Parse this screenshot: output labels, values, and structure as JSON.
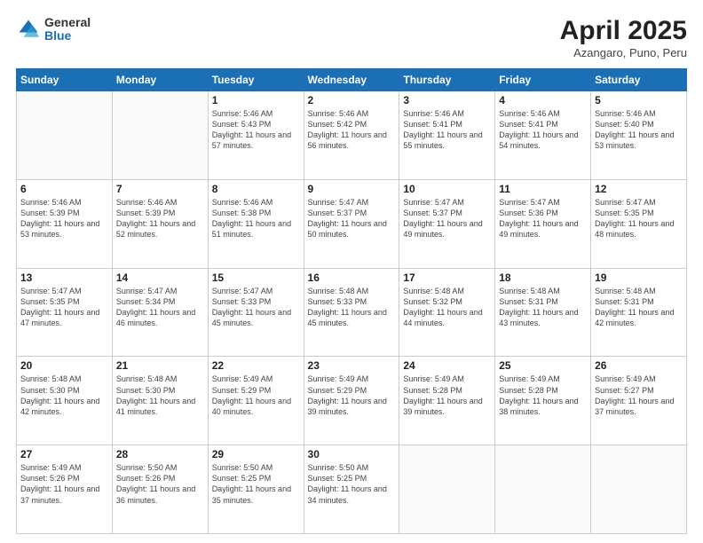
{
  "header": {
    "logo_general": "General",
    "logo_blue": "Blue",
    "title": "April 2025",
    "subtitle": "Azangaro, Puno, Peru"
  },
  "calendar": {
    "weekdays": [
      "Sunday",
      "Monday",
      "Tuesday",
      "Wednesday",
      "Thursday",
      "Friday",
      "Saturday"
    ],
    "weeks": [
      [
        {
          "day": "",
          "sunrise": "",
          "sunset": "",
          "daylight": ""
        },
        {
          "day": "",
          "sunrise": "",
          "sunset": "",
          "daylight": ""
        },
        {
          "day": "1",
          "sunrise": "Sunrise: 5:46 AM",
          "sunset": "Sunset: 5:43 PM",
          "daylight": "Daylight: 11 hours and 57 minutes."
        },
        {
          "day": "2",
          "sunrise": "Sunrise: 5:46 AM",
          "sunset": "Sunset: 5:42 PM",
          "daylight": "Daylight: 11 hours and 56 minutes."
        },
        {
          "day": "3",
          "sunrise": "Sunrise: 5:46 AM",
          "sunset": "Sunset: 5:41 PM",
          "daylight": "Daylight: 11 hours and 55 minutes."
        },
        {
          "day": "4",
          "sunrise": "Sunrise: 5:46 AM",
          "sunset": "Sunset: 5:41 PM",
          "daylight": "Daylight: 11 hours and 54 minutes."
        },
        {
          "day": "5",
          "sunrise": "Sunrise: 5:46 AM",
          "sunset": "Sunset: 5:40 PM",
          "daylight": "Daylight: 11 hours and 53 minutes."
        }
      ],
      [
        {
          "day": "6",
          "sunrise": "Sunrise: 5:46 AM",
          "sunset": "Sunset: 5:39 PM",
          "daylight": "Daylight: 11 hours and 53 minutes."
        },
        {
          "day": "7",
          "sunrise": "Sunrise: 5:46 AM",
          "sunset": "Sunset: 5:39 PM",
          "daylight": "Daylight: 11 hours and 52 minutes."
        },
        {
          "day": "8",
          "sunrise": "Sunrise: 5:46 AM",
          "sunset": "Sunset: 5:38 PM",
          "daylight": "Daylight: 11 hours and 51 minutes."
        },
        {
          "day": "9",
          "sunrise": "Sunrise: 5:47 AM",
          "sunset": "Sunset: 5:37 PM",
          "daylight": "Daylight: 11 hours and 50 minutes."
        },
        {
          "day": "10",
          "sunrise": "Sunrise: 5:47 AM",
          "sunset": "Sunset: 5:37 PM",
          "daylight": "Daylight: 11 hours and 49 minutes."
        },
        {
          "day": "11",
          "sunrise": "Sunrise: 5:47 AM",
          "sunset": "Sunset: 5:36 PM",
          "daylight": "Daylight: 11 hours and 49 minutes."
        },
        {
          "day": "12",
          "sunrise": "Sunrise: 5:47 AM",
          "sunset": "Sunset: 5:35 PM",
          "daylight": "Daylight: 11 hours and 48 minutes."
        }
      ],
      [
        {
          "day": "13",
          "sunrise": "Sunrise: 5:47 AM",
          "sunset": "Sunset: 5:35 PM",
          "daylight": "Daylight: 11 hours and 47 minutes."
        },
        {
          "day": "14",
          "sunrise": "Sunrise: 5:47 AM",
          "sunset": "Sunset: 5:34 PM",
          "daylight": "Daylight: 11 hours and 46 minutes."
        },
        {
          "day": "15",
          "sunrise": "Sunrise: 5:47 AM",
          "sunset": "Sunset: 5:33 PM",
          "daylight": "Daylight: 11 hours and 45 minutes."
        },
        {
          "day": "16",
          "sunrise": "Sunrise: 5:48 AM",
          "sunset": "Sunset: 5:33 PM",
          "daylight": "Daylight: 11 hours and 45 minutes."
        },
        {
          "day": "17",
          "sunrise": "Sunrise: 5:48 AM",
          "sunset": "Sunset: 5:32 PM",
          "daylight": "Daylight: 11 hours and 44 minutes."
        },
        {
          "day": "18",
          "sunrise": "Sunrise: 5:48 AM",
          "sunset": "Sunset: 5:31 PM",
          "daylight": "Daylight: 11 hours and 43 minutes."
        },
        {
          "day": "19",
          "sunrise": "Sunrise: 5:48 AM",
          "sunset": "Sunset: 5:31 PM",
          "daylight": "Daylight: 11 hours and 42 minutes."
        }
      ],
      [
        {
          "day": "20",
          "sunrise": "Sunrise: 5:48 AM",
          "sunset": "Sunset: 5:30 PM",
          "daylight": "Daylight: 11 hours and 42 minutes."
        },
        {
          "day": "21",
          "sunrise": "Sunrise: 5:48 AM",
          "sunset": "Sunset: 5:30 PM",
          "daylight": "Daylight: 11 hours and 41 minutes."
        },
        {
          "day": "22",
          "sunrise": "Sunrise: 5:49 AM",
          "sunset": "Sunset: 5:29 PM",
          "daylight": "Daylight: 11 hours and 40 minutes."
        },
        {
          "day": "23",
          "sunrise": "Sunrise: 5:49 AM",
          "sunset": "Sunset: 5:29 PM",
          "daylight": "Daylight: 11 hours and 39 minutes."
        },
        {
          "day": "24",
          "sunrise": "Sunrise: 5:49 AM",
          "sunset": "Sunset: 5:28 PM",
          "daylight": "Daylight: 11 hours and 39 minutes."
        },
        {
          "day": "25",
          "sunrise": "Sunrise: 5:49 AM",
          "sunset": "Sunset: 5:28 PM",
          "daylight": "Daylight: 11 hours and 38 minutes."
        },
        {
          "day": "26",
          "sunrise": "Sunrise: 5:49 AM",
          "sunset": "Sunset: 5:27 PM",
          "daylight": "Daylight: 11 hours and 37 minutes."
        }
      ],
      [
        {
          "day": "27",
          "sunrise": "Sunrise: 5:49 AM",
          "sunset": "Sunset: 5:26 PM",
          "daylight": "Daylight: 11 hours and 37 minutes."
        },
        {
          "day": "28",
          "sunrise": "Sunrise: 5:50 AM",
          "sunset": "Sunset: 5:26 PM",
          "daylight": "Daylight: 11 hours and 36 minutes."
        },
        {
          "day": "29",
          "sunrise": "Sunrise: 5:50 AM",
          "sunset": "Sunset: 5:25 PM",
          "daylight": "Daylight: 11 hours and 35 minutes."
        },
        {
          "day": "30",
          "sunrise": "Sunrise: 5:50 AM",
          "sunset": "Sunset: 5:25 PM",
          "daylight": "Daylight: 11 hours and 34 minutes."
        },
        {
          "day": "",
          "sunrise": "",
          "sunset": "",
          "daylight": ""
        },
        {
          "day": "",
          "sunrise": "",
          "sunset": "",
          "daylight": ""
        },
        {
          "day": "",
          "sunrise": "",
          "sunset": "",
          "daylight": ""
        }
      ]
    ]
  }
}
